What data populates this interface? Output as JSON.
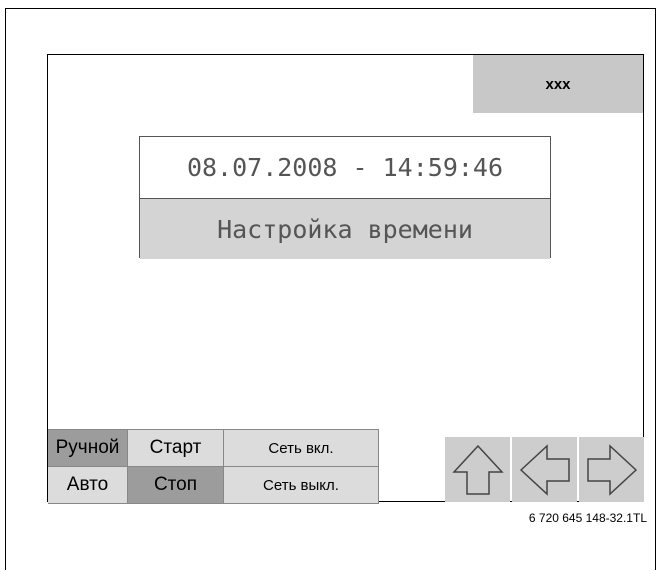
{
  "header": {
    "title": "xxx"
  },
  "clock": {
    "datetime": "08.07.2008 - 14:59:46",
    "setup_label": "Настройка времени"
  },
  "modes": {
    "manual": "Ручной",
    "auto": "Авто",
    "start": "Старт",
    "stop": "Стоп",
    "net_on": "Сеть вкл.",
    "net_off": "Сеть выкл."
  },
  "navigation": {
    "icons": [
      "arrow-up-icon",
      "arrow-left-icon",
      "arrow-right-icon"
    ]
  },
  "figure_id": "6 720 645 148-32.1TL",
  "colors": {
    "active_button": "#9c9c9c",
    "inactive_button": "#dcdcdc",
    "title_bar": "#c8c8c8",
    "arrow_button": "#cdcdcd"
  }
}
